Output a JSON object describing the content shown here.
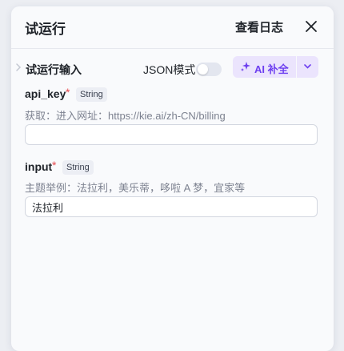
{
  "header": {
    "title": "试运行",
    "view_log_label": "查看日志",
    "close_icon": "close-icon"
  },
  "section": {
    "title": "试运行输入",
    "json_mode_label": "JSON模式",
    "json_mode_on": false,
    "ai_fill_label": "AI 补全",
    "ai_icon": "sparkle-icon",
    "dropdown_icon": "chevron-down-icon"
  },
  "fields": [
    {
      "name": "api_key",
      "required_mark": "*",
      "type": "String",
      "hint": "获取：进入网址：https://kie.ai/zh-CN/billing",
      "value": ""
    },
    {
      "name": "input",
      "required_mark": "*",
      "type": "String",
      "hint": "主题举例：法拉利，美乐蒂，哆啦 A 梦，宜家等",
      "value": "法拉利"
    }
  ],
  "colors": {
    "accent": "#6d3ff0",
    "accent_bg": "#ebe4fd",
    "required": "#e5484d"
  }
}
